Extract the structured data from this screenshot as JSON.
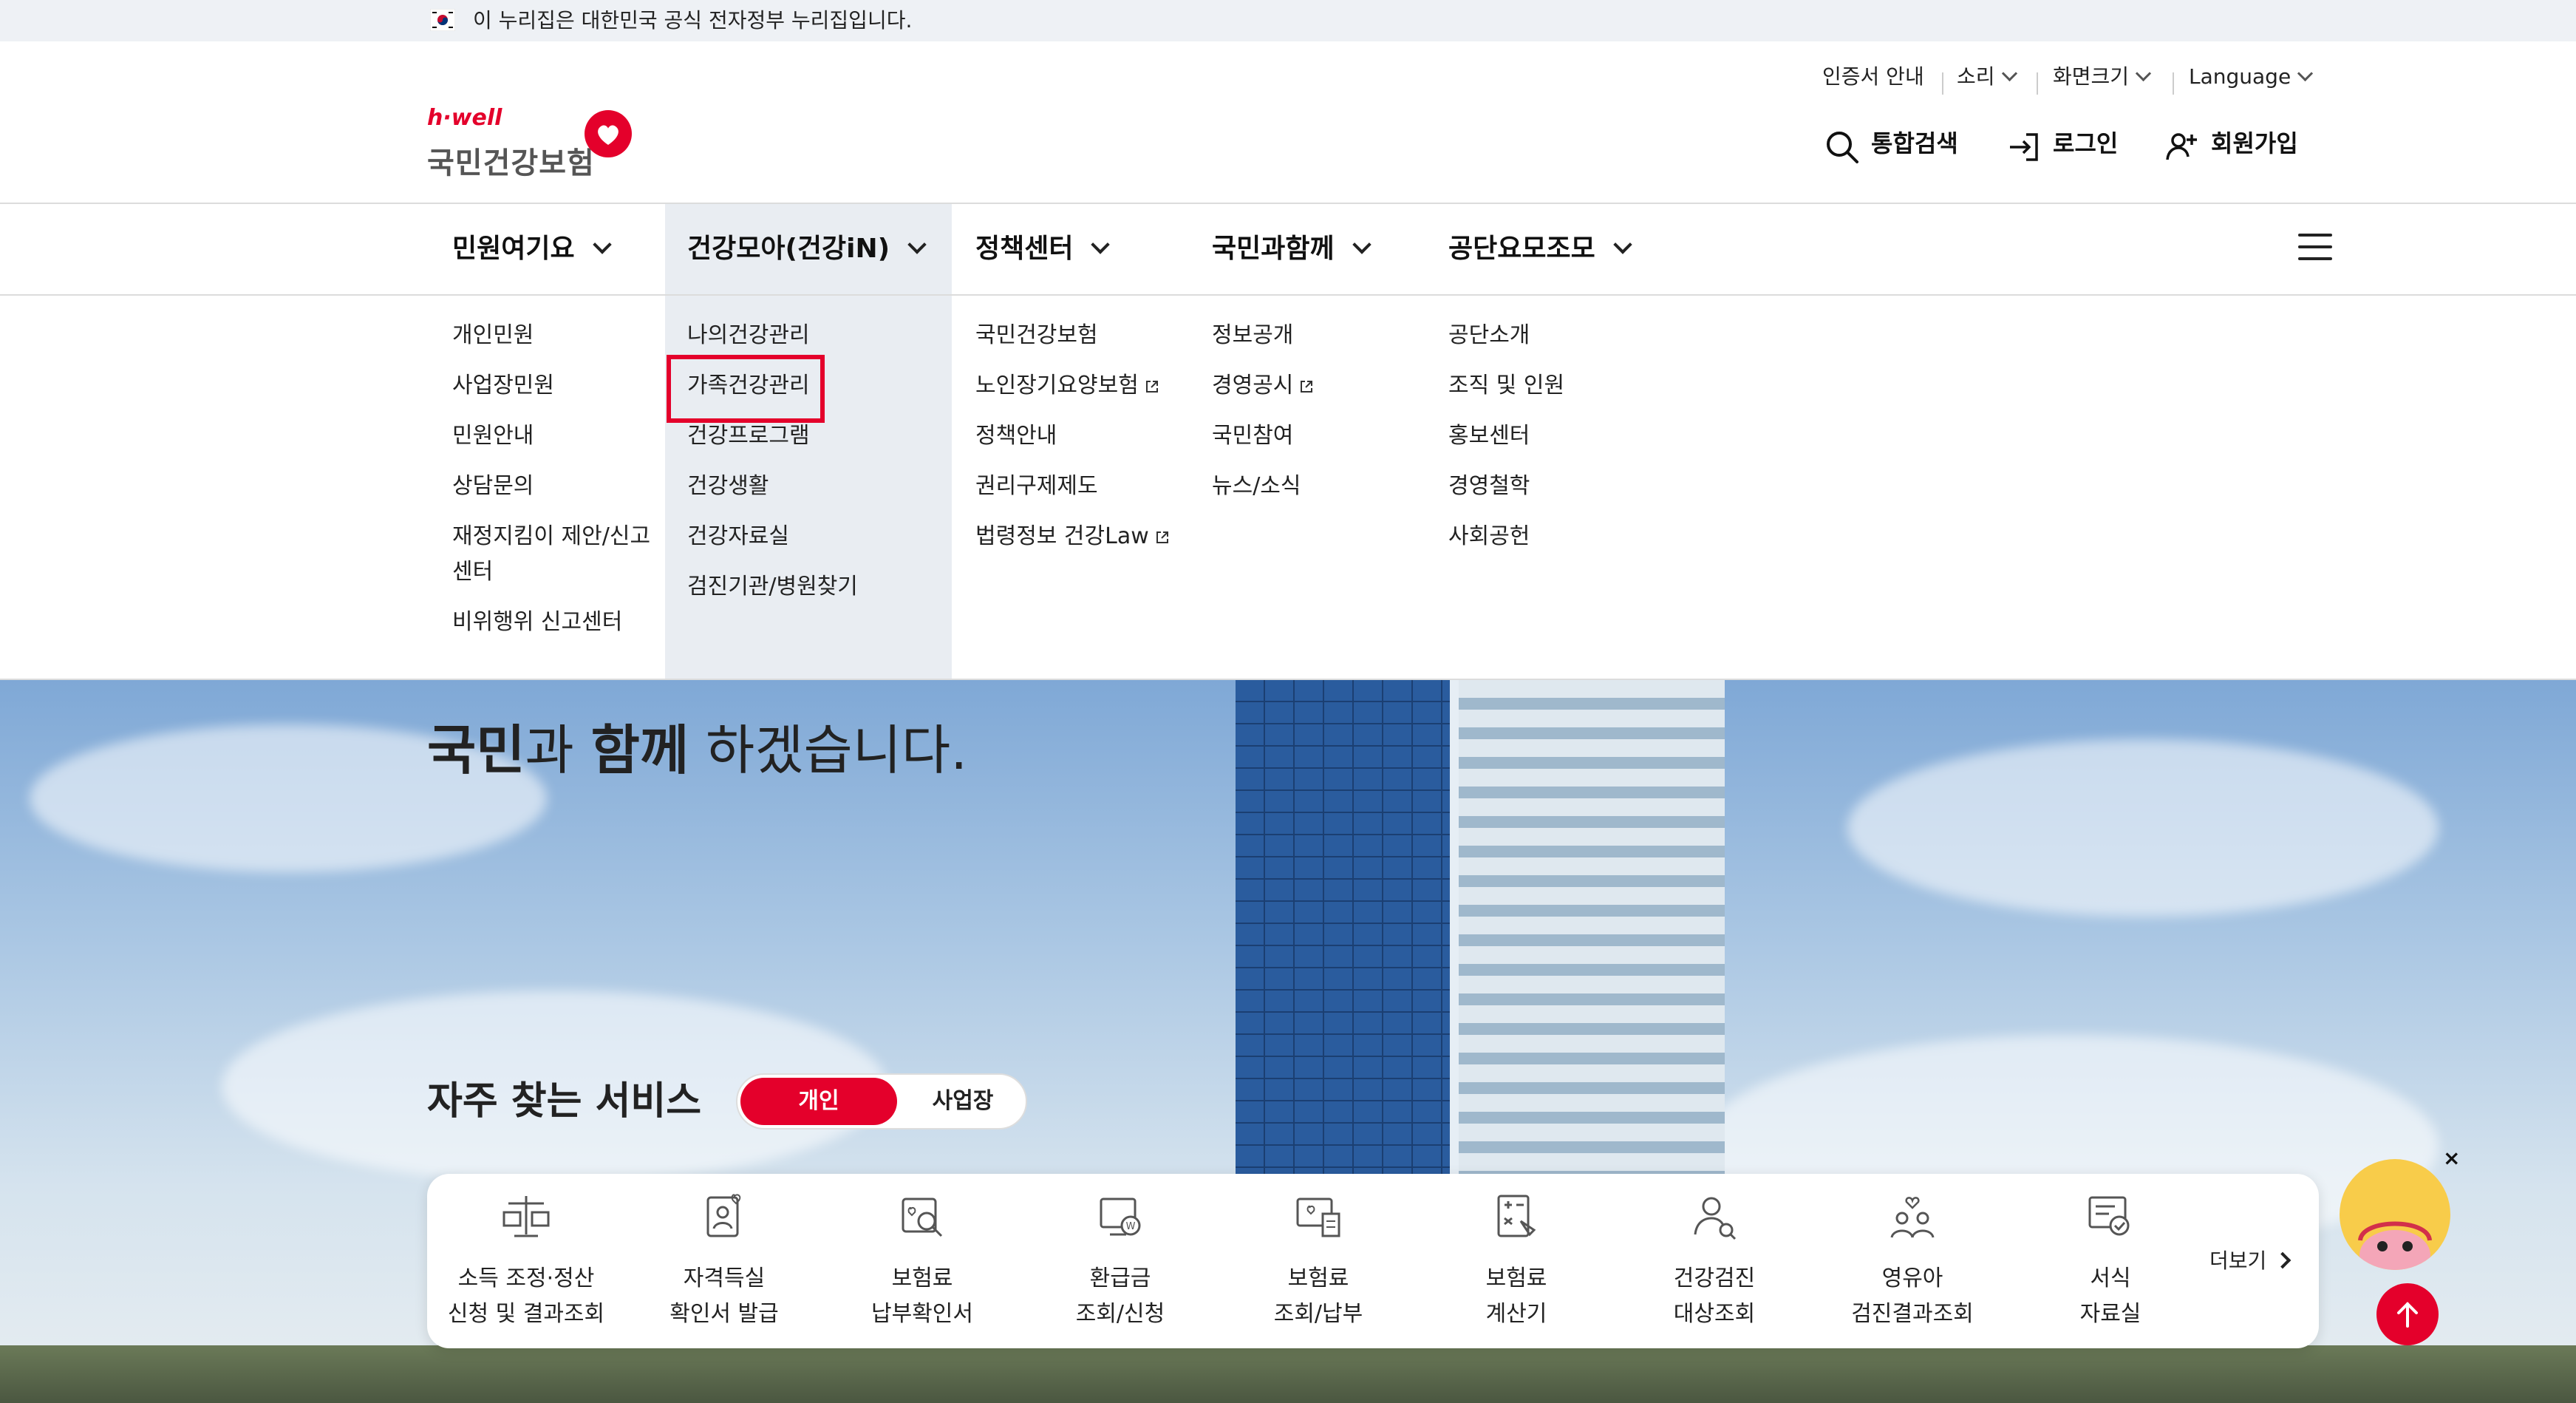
{
  "gov_banner": {
    "text": "이 누리집은 대한민국 공식 전자정부 누리집입니다."
  },
  "utility": {
    "cert": "인증서 안내",
    "sound": "소리",
    "screen_size": "화면크기",
    "language": "Language"
  },
  "logo": {
    "brand": "h·well",
    "name": "국민건강보험"
  },
  "top_actions": {
    "search": "통합검색",
    "login": "로그인",
    "signup": "회원가입"
  },
  "gnb": [
    {
      "label": "민원여기요"
    },
    {
      "label": "건강모아(건강iN)"
    },
    {
      "label": "정책센터"
    },
    {
      "label": "국민과함께"
    },
    {
      "label": "공단요모조모"
    }
  ],
  "mega": {
    "col1": [
      "개인민원",
      "사업장민원",
      "민원안내",
      "상담문의",
      "재정지킴이 제안/신고",
      "센터",
      "비위행위 신고센터"
    ],
    "col2": [
      "나의건강관리",
      "가족건강관리",
      "건강프로그램",
      "건강생활",
      "건강자료실",
      "검진기관/병원찾기"
    ],
    "col3": [
      "국민건강보험",
      "노인장기요양보험",
      "정책안내",
      "권리구제제도",
      "법령정보 건강Law"
    ],
    "col4": [
      "정보공개",
      "경영공시",
      "국민참여",
      "뉴스/소식"
    ],
    "col5": [
      "공단소개",
      "조직 및 인원",
      "홍보센터",
      "경영철학",
      "사회공헌"
    ]
  },
  "hero": {
    "line_bold1": "국민",
    "line_mid1": "과 ",
    "line_bold2": "함께",
    "line_rest": " 하겠습니다."
  },
  "services": {
    "title": "자주 찾는 서비스",
    "toggle_on": "개인",
    "toggle_off": "사업장",
    "more": "더보기",
    "items": [
      {
        "l1": "소득 조정·정산",
        "l2": "신청 및 결과조회",
        "icon": "scale-icon"
      },
      {
        "l1": "자격득실",
        "l2": "확인서 발급",
        "icon": "id-card-icon"
      },
      {
        "l1": "보험료",
        "l2": "납부확인서",
        "icon": "document-search-icon"
      },
      {
        "l1": "환급금",
        "l2": "조회/신청",
        "icon": "refund-icon"
      },
      {
        "l1": "보험료",
        "l2": "조회/납부",
        "icon": "payment-icon"
      },
      {
        "l1": "보험료",
        "l2": "계산기",
        "icon": "calculator-icon"
      },
      {
        "l1": "건강검진",
        "l2": "대상조회",
        "icon": "person-search-icon"
      },
      {
        "l1": "영유아",
        "l2": "검진결과조회",
        "icon": "family-icon"
      },
      {
        "l1": "서식",
        "l2": "자료실",
        "icon": "form-icon"
      }
    ]
  },
  "colors": {
    "brand_red": "#e4002b",
    "gnb_active_bg": "#e9edf2"
  }
}
